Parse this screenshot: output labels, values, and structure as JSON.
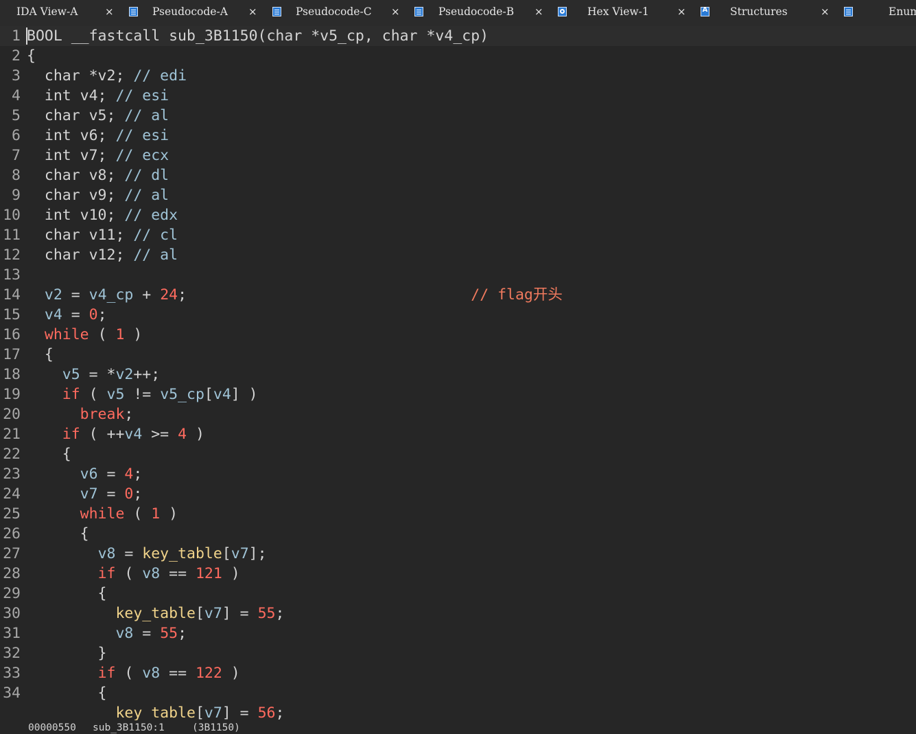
{
  "tabs": [
    {
      "label": "IDA View-A",
      "icon": "none",
      "active": false
    },
    {
      "label": "Pseudocode-A",
      "icon": "pseudocode-icon",
      "active": true
    },
    {
      "label": "Pseudocode-C",
      "icon": "pseudocode-icon",
      "active": false
    },
    {
      "label": "Pseudocode-B",
      "icon": "pseudocode-icon",
      "active": false
    },
    {
      "label": "Hex View-1",
      "icon": "hex-view-icon",
      "active": false
    },
    {
      "label": "Structures",
      "icon": "structures-icon",
      "active": false
    },
    {
      "label": "Enums",
      "icon": "enums-icon",
      "active": false
    }
  ],
  "tab_close_glyph": "×",
  "code_lines": [
    {
      "n": "1",
      "tokens": [
        [
          "t-plain",
          "BOOL __fastcall sub_3B1150(char *v5_cp, char *v4_cp)"
        ]
      ]
    },
    {
      "n": "2",
      "tokens": [
        [
          "t-plain",
          "{"
        ]
      ]
    },
    {
      "n": "3",
      "tokens": [
        [
          "t-plain",
          "  char *v2; "
        ],
        [
          "t-cmt",
          "// edi"
        ]
      ]
    },
    {
      "n": "4",
      "tokens": [
        [
          "t-plain",
          "  int v4; "
        ],
        [
          "t-cmt",
          "// esi"
        ]
      ]
    },
    {
      "n": "5",
      "tokens": [
        [
          "t-plain",
          "  char v5; "
        ],
        [
          "t-cmt",
          "// al"
        ]
      ]
    },
    {
      "n": "6",
      "tokens": [
        [
          "t-plain",
          "  int v6; "
        ],
        [
          "t-cmt",
          "// esi"
        ]
      ]
    },
    {
      "n": "7",
      "tokens": [
        [
          "t-plain",
          "  int v7; "
        ],
        [
          "t-cmt",
          "// ecx"
        ]
      ]
    },
    {
      "n": "8",
      "tokens": [
        [
          "t-plain",
          "  char v8; "
        ],
        [
          "t-cmt",
          "// dl"
        ]
      ]
    },
    {
      "n": "9",
      "tokens": [
        [
          "t-plain",
          "  char v9; "
        ],
        [
          "t-cmt",
          "// al"
        ]
      ]
    },
    {
      "n": "10",
      "tokens": [
        [
          "t-plain",
          "  int v10; "
        ],
        [
          "t-cmt",
          "// edx"
        ]
      ]
    },
    {
      "n": "11",
      "tokens": [
        [
          "t-plain",
          "  char v11; "
        ],
        [
          "t-cmt",
          "// cl"
        ]
      ]
    },
    {
      "n": "12",
      "tokens": [
        [
          "t-plain",
          "  char v12; "
        ],
        [
          "t-cmt",
          "// al"
        ]
      ]
    },
    {
      "n": "13",
      "tokens": []
    },
    {
      "n": "14",
      "tokens": [
        [
          "t-plain",
          "  "
        ],
        [
          "t-var",
          "v2"
        ],
        [
          "t-plain",
          " = "
        ],
        [
          "t-var",
          "v4_cp"
        ],
        [
          "t-plain",
          " + "
        ],
        [
          "t-num",
          "24"
        ],
        [
          "t-plain",
          ";                                "
        ],
        [
          "t-cmt2",
          "// flag"
        ],
        [
          "t-cmt2 t-cjk",
          "开头"
        ]
      ]
    },
    {
      "n": "15",
      "tokens": [
        [
          "t-plain",
          "  "
        ],
        [
          "t-var",
          "v4"
        ],
        [
          "t-plain",
          " = "
        ],
        [
          "t-num",
          "0"
        ],
        [
          "t-plain",
          ";"
        ]
      ]
    },
    {
      "n": "16",
      "tokens": [
        [
          "t-plain",
          "  "
        ],
        [
          "t-kw",
          "while"
        ],
        [
          "t-plain",
          " ( "
        ],
        [
          "t-num",
          "1"
        ],
        [
          "t-plain",
          " )"
        ]
      ]
    },
    {
      "n": "17",
      "tokens": [
        [
          "t-plain",
          "  {"
        ]
      ]
    },
    {
      "n": "18",
      "tokens": [
        [
          "t-plain",
          "    "
        ],
        [
          "t-var",
          "v5"
        ],
        [
          "t-plain",
          " = *"
        ],
        [
          "t-var",
          "v2"
        ],
        [
          "t-plain",
          "++;"
        ]
      ]
    },
    {
      "n": "19",
      "tokens": [
        [
          "t-plain",
          "    "
        ],
        [
          "t-kw",
          "if"
        ],
        [
          "t-plain",
          " ( "
        ],
        [
          "t-var",
          "v5"
        ],
        [
          "t-plain",
          " != "
        ],
        [
          "t-var",
          "v5_cp"
        ],
        [
          "t-plain",
          "["
        ],
        [
          "t-var",
          "v4"
        ],
        [
          "t-plain",
          "] )"
        ]
      ]
    },
    {
      "n": "20",
      "tokens": [
        [
          "t-plain",
          "      "
        ],
        [
          "t-kw",
          "break"
        ],
        [
          "t-plain",
          ";"
        ]
      ]
    },
    {
      "n": "21",
      "tokens": [
        [
          "t-plain",
          "    "
        ],
        [
          "t-kw",
          "if"
        ],
        [
          "t-plain",
          " ( ++"
        ],
        [
          "t-var",
          "v4"
        ],
        [
          "t-plain",
          " >= "
        ],
        [
          "t-num",
          "4"
        ],
        [
          "t-plain",
          " )"
        ]
      ]
    },
    {
      "n": "22",
      "tokens": [
        [
          "t-plain",
          "    {"
        ]
      ]
    },
    {
      "n": "23",
      "tokens": [
        [
          "t-plain",
          "      "
        ],
        [
          "t-var",
          "v6"
        ],
        [
          "t-plain",
          " = "
        ],
        [
          "t-num",
          "4"
        ],
        [
          "t-plain",
          ";"
        ]
      ]
    },
    {
      "n": "24",
      "tokens": [
        [
          "t-plain",
          "      "
        ],
        [
          "t-var",
          "v7"
        ],
        [
          "t-plain",
          " = "
        ],
        [
          "t-num",
          "0"
        ],
        [
          "t-plain",
          ";"
        ]
      ]
    },
    {
      "n": "25",
      "tokens": [
        [
          "t-plain",
          "      "
        ],
        [
          "t-kw",
          "while"
        ],
        [
          "t-plain",
          " ( "
        ],
        [
          "t-num",
          "1"
        ],
        [
          "t-plain",
          " )"
        ]
      ]
    },
    {
      "n": "26",
      "tokens": [
        [
          "t-plain",
          "      {"
        ]
      ]
    },
    {
      "n": "27",
      "tokens": [
        [
          "t-plain",
          "        "
        ],
        [
          "t-var",
          "v8"
        ],
        [
          "t-plain",
          " = "
        ],
        [
          "t-glob",
          "key_table"
        ],
        [
          "t-plain",
          "["
        ],
        [
          "t-var",
          "v7"
        ],
        [
          "t-plain",
          "];"
        ]
      ]
    },
    {
      "n": "28",
      "tokens": [
        [
          "t-plain",
          "        "
        ],
        [
          "t-kw",
          "if"
        ],
        [
          "t-plain",
          " ( "
        ],
        [
          "t-var",
          "v8"
        ],
        [
          "t-plain",
          " == "
        ],
        [
          "t-num",
          "121"
        ],
        [
          "t-plain",
          " )"
        ]
      ]
    },
    {
      "n": "29",
      "tokens": [
        [
          "t-plain",
          "        {"
        ]
      ]
    },
    {
      "n": "30",
      "tokens": [
        [
          "t-plain",
          "          "
        ],
        [
          "t-glob",
          "key_table"
        ],
        [
          "t-plain",
          "["
        ],
        [
          "t-var",
          "v7"
        ],
        [
          "t-plain",
          "] = "
        ],
        [
          "t-num",
          "55"
        ],
        [
          "t-plain",
          ";"
        ]
      ]
    },
    {
      "n": "31",
      "tokens": [
        [
          "t-plain",
          "          "
        ],
        [
          "t-var",
          "v8"
        ],
        [
          "t-plain",
          " = "
        ],
        [
          "t-num",
          "55"
        ],
        [
          "t-plain",
          ";"
        ]
      ]
    },
    {
      "n": "32",
      "tokens": [
        [
          "t-plain",
          "        }"
        ]
      ]
    },
    {
      "n": "33",
      "tokens": [
        [
          "t-plain",
          "        "
        ],
        [
          "t-kw",
          "if"
        ],
        [
          "t-plain",
          " ( "
        ],
        [
          "t-var",
          "v8"
        ],
        [
          "t-plain",
          " == "
        ],
        [
          "t-num",
          "122"
        ],
        [
          "t-plain",
          " )"
        ]
      ]
    },
    {
      "n": "34",
      "tokens": [
        [
          "t-plain",
          "        {"
        ]
      ]
    },
    {
      "n": "",
      "tokens": [
        [
          "t-plain",
          "          "
        ],
        [
          "t-glob",
          "key_table"
        ],
        [
          "t-plain",
          "["
        ],
        [
          "t-var",
          "v7"
        ],
        [
          "t-plain",
          "] = "
        ],
        [
          "t-num",
          "56"
        ],
        [
          "t-plain",
          ";"
        ]
      ]
    }
  ],
  "status": {
    "offset": "00000550",
    "location": "sub_3B1150:1",
    "address": "(3B1150)"
  }
}
